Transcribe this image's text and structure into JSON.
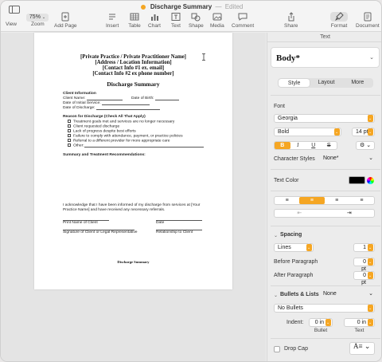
{
  "window": {
    "title": "Discharge Summary",
    "separator": "—",
    "status": "Edited"
  },
  "toolbar": {
    "view": "View",
    "zoom": "Zoom",
    "zoom_value": "75%",
    "add_page": "Add Page",
    "insert": "Insert",
    "table": "Table",
    "chart": "Chart",
    "text": "Text",
    "shape": "Shape",
    "media": "Media",
    "comment": "Comment",
    "share": "Share",
    "format": "Format",
    "document": "Document"
  },
  "document": {
    "header": [
      "[Private Practice / Private Practitioner Name]",
      "[Address / Location Information]",
      "[Contact Info #1 ex. email]",
      "[Contact Info #2 ex phone number]"
    ],
    "title": "Discharge Summary",
    "client_info_heading": "Client Information",
    "client_name": "Client Name:",
    "dob": "Date of Birth:",
    "initial_service": "Date of Initial Service:",
    "discharge_date": "Date of Discharge:",
    "reason_heading": "Reason for Discharge (Check All That Apply)",
    "reasons": [
      "Treatment goals met and services are no longer necessary",
      "Client requested discharge",
      "Lack of progress despite best efforts",
      "Failure to comply with attendance, payment, or practice policies",
      "Referral to a different provider for more appropriate care",
      "Other:"
    ],
    "summary_heading": "Summary and Treatment Recommendations:",
    "ack_line1": "I acknowledge that I have been informed of my discharge from services at [Your",
    "ack_line2": "Practice Name] and have received any necessary referrals.",
    "print_name": "Print Name of Client",
    "date1": "Date",
    "signature": "Signature of Client  or Legal Representative",
    "relationship": "Relationship to Client",
    "footer": "Discharge Summary"
  },
  "inspector": {
    "panel_title": "Text",
    "style_name": "Body*",
    "tabs": [
      "Style",
      "Layout",
      "More"
    ],
    "font_label": "Font",
    "font_family": "Georgia",
    "font_weight": "Bold",
    "font_size": "14 pt",
    "char_styles_label": "Character Styles",
    "char_styles_value": "None*",
    "text_color_label": "Text Color",
    "text_color": "#000000",
    "spacing_label": "Spacing",
    "spacing_mode": "Lines",
    "spacing_value": "1",
    "before_para_label": "Before Paragraph",
    "before_para_value": "0 pt",
    "after_para_label": "After Paragraph",
    "after_para_value": "0 pt",
    "bullets_label": "Bullets & Lists",
    "bullets_value": "None",
    "bullets_style": "No Bullets",
    "indent_label": "Indent:",
    "bullet_indent": "0 in",
    "text_indent": "0 in",
    "bullet_sub": "Bullet",
    "text_sub": "Text",
    "drop_cap_label": "Drop Cap",
    "accent_color": "#f5a623"
  }
}
